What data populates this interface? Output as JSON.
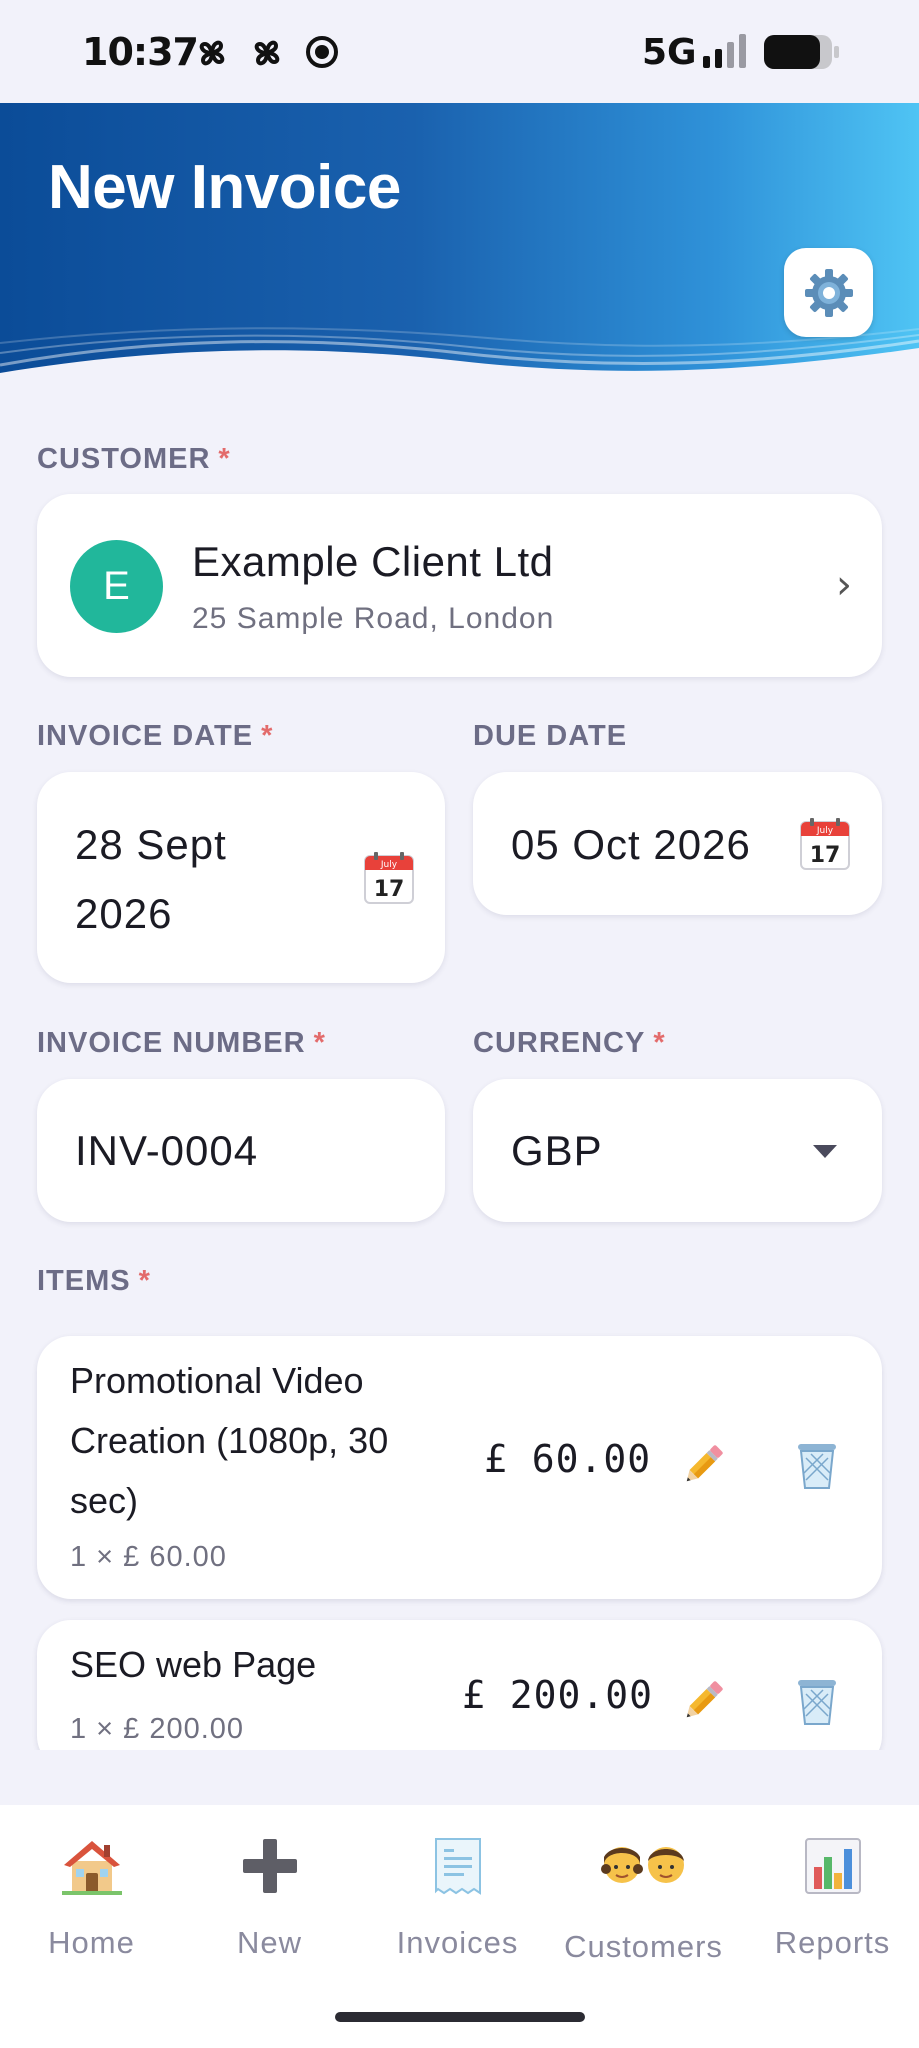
{
  "status_bar": {
    "time": "10:37",
    "network": "5G",
    "icons": [
      "pinwheel-icon",
      "pinwheel-icon",
      "record-icon",
      "signal-icon",
      "battery-icon"
    ]
  },
  "header": {
    "title": "New Invoice",
    "settings_icon": "gear-icon",
    "colors": {
      "start": "#0B4C98",
      "end": "#4FC4F4"
    }
  },
  "customer": {
    "label": "CUSTOMER",
    "required": "*",
    "avatar_initial": "E",
    "avatar_color": "#21B79B",
    "name": "Example Client Ltd",
    "address": "25 Sample Road, London",
    "chevron": "›"
  },
  "invoice_date": {
    "label": "INVOICE DATE",
    "required": "*",
    "value_line1": "28 Sept",
    "value_line2": "2026",
    "icon": "calendar-icon",
    "icon_month": "July",
    "icon_day": "17"
  },
  "due_date": {
    "label": "DUE DATE",
    "value": "05 Oct 2026",
    "icon": "calendar-icon",
    "icon_month": "July",
    "icon_day": "17"
  },
  "invoice_number": {
    "label": "INVOICE NUMBER",
    "required": "*",
    "value": "INV-0004"
  },
  "currency": {
    "label": "CURRENCY",
    "required": "*",
    "value": "GBP"
  },
  "items": {
    "label": "ITEMS",
    "required": "*",
    "list": [
      {
        "desc_lines": [
          "Promotional Video",
          "Creation (1080p, 30",
          "sec)"
        ],
        "qty": "1 × £ 60.00",
        "amount": "£ 60.00",
        "edit_icon": "pencil-icon",
        "delete_icon": "trash-icon"
      },
      {
        "desc_lines": [
          "SEO web Page"
        ],
        "qty": "1 × £ 200.00",
        "amount": "£ 200.00",
        "edit_icon": "pencil-icon",
        "delete_icon": "trash-icon"
      }
    ]
  },
  "bottom_nav": [
    {
      "label": "Home",
      "icon": "house-icon"
    },
    {
      "label": "New",
      "icon": "plus-icon"
    },
    {
      "label": "Invoices",
      "icon": "receipt-icon"
    },
    {
      "label": "Customers",
      "icon": "people-icon"
    },
    {
      "label": "Reports",
      "icon": "bar-chart-icon"
    }
  ]
}
